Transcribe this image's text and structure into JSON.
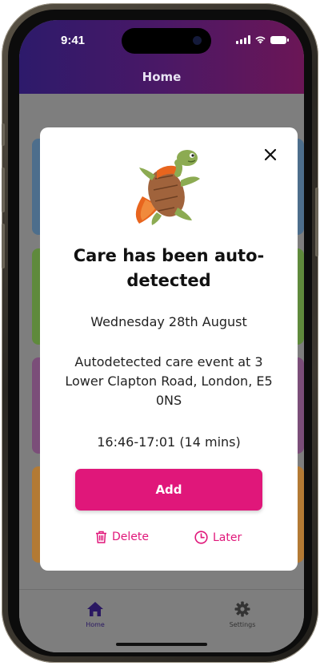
{
  "status_bar": {
    "time": "9:41"
  },
  "header": {
    "title": "Home"
  },
  "modal": {
    "title": "Care has been auto-detected",
    "date": "Wednesday 28th August",
    "description": "Autodetected care event at 3 Lower Clapton Road, London, E5 0NS",
    "time_range": "16:46-17:01 (14 mins)",
    "add_label": "Add",
    "delete_label": "Delete",
    "later_label": "Later",
    "close_icon": "close-icon",
    "illustration": "turtle-superhero-illustration"
  },
  "tab_bar": {
    "items": [
      {
        "label": "Home",
        "icon": "home-icon",
        "active": true
      },
      {
        "label": "Settings",
        "icon": "gear-icon",
        "active": false
      }
    ]
  },
  "colors": {
    "accent": "#e0177a",
    "header_gradient_start": "#2d1a6b",
    "header_gradient_end": "#6b1656",
    "active_tab": "#2a1862"
  }
}
